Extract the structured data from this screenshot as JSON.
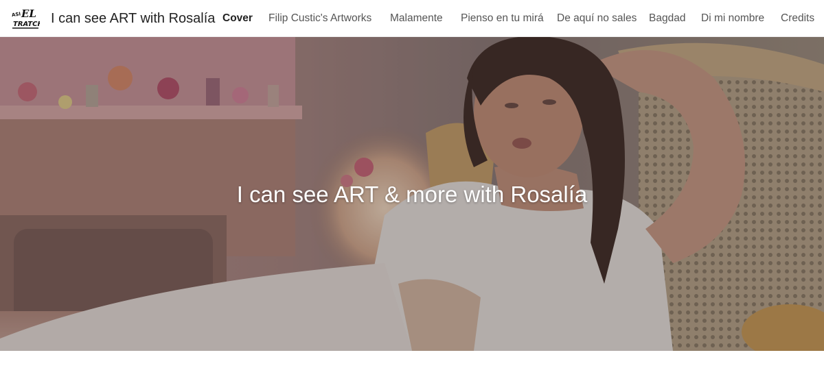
{
  "header": {
    "logo_text": "ASI EL TRATCHS",
    "site_title": "I can see ART with Rosalía"
  },
  "nav": {
    "items": [
      {
        "label": "Cover",
        "active": true
      },
      {
        "label": "Filip Custic's Artworks",
        "active": false
      },
      {
        "label": "Malamente",
        "active": false
      },
      {
        "label": "Pienso en tu mirá",
        "active": false
      },
      {
        "label": "De aquí no sales",
        "active": false
      },
      {
        "label": "Bagdad",
        "active": false
      },
      {
        "label": "Di mi nombre",
        "active": false
      },
      {
        "label": "Credits",
        "active": false
      }
    ]
  },
  "hero": {
    "title": "I can see ART & more with Rosalía",
    "image": "photo of woman in white outfit reclining on a cane-backed chair in a pink room"
  },
  "colors": {
    "nav_active": "#222222",
    "nav_inactive": "#555555",
    "hero_text": "#ffffff"
  }
}
